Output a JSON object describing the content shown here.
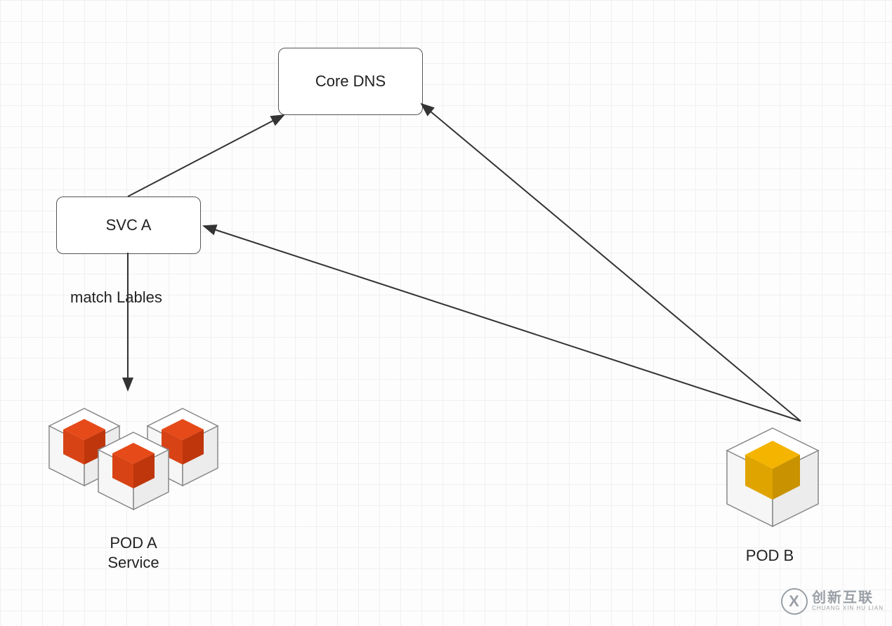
{
  "nodes": {
    "core_dns": {
      "label": "Core DNS"
    },
    "svc_a": {
      "label": "SVC A"
    }
  },
  "edges": {
    "svc_to_pods": {
      "label": "match Lables"
    }
  },
  "pods": {
    "pod_a": {
      "label": "POD A\nService"
    },
    "pod_b": {
      "label": "POD B"
    }
  },
  "colors": {
    "pod_a_cube": "#e64a19",
    "pod_b_cube": "#f5b400",
    "node_border": "#555555",
    "arrow": "#333333"
  },
  "watermark": {
    "icon_text": "X",
    "line1": "创新互联",
    "line2": "CHUANG XIN HU LIAN"
  }
}
